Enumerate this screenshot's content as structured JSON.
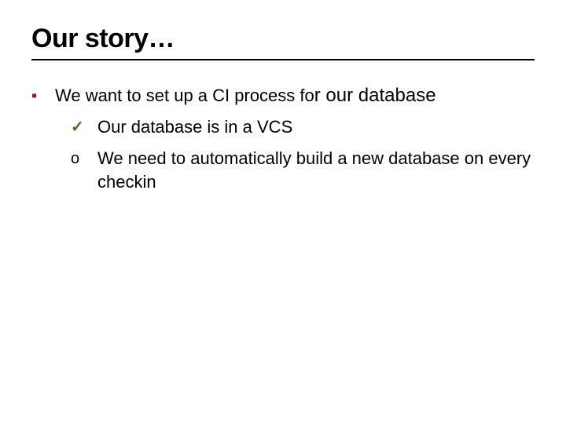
{
  "title": "Our story…",
  "main_point": {
    "lead": "We want to set up a CI process fo",
    "trail": "r our database"
  },
  "sub_points": [
    {
      "marker": "check",
      "text": "Our database is in a VCS"
    },
    {
      "marker": "circle",
      "text": "We need to automatically build a new database on every checkin"
    }
  ],
  "markers": {
    "square": "▪",
    "check": "✓",
    "circle": "o"
  }
}
